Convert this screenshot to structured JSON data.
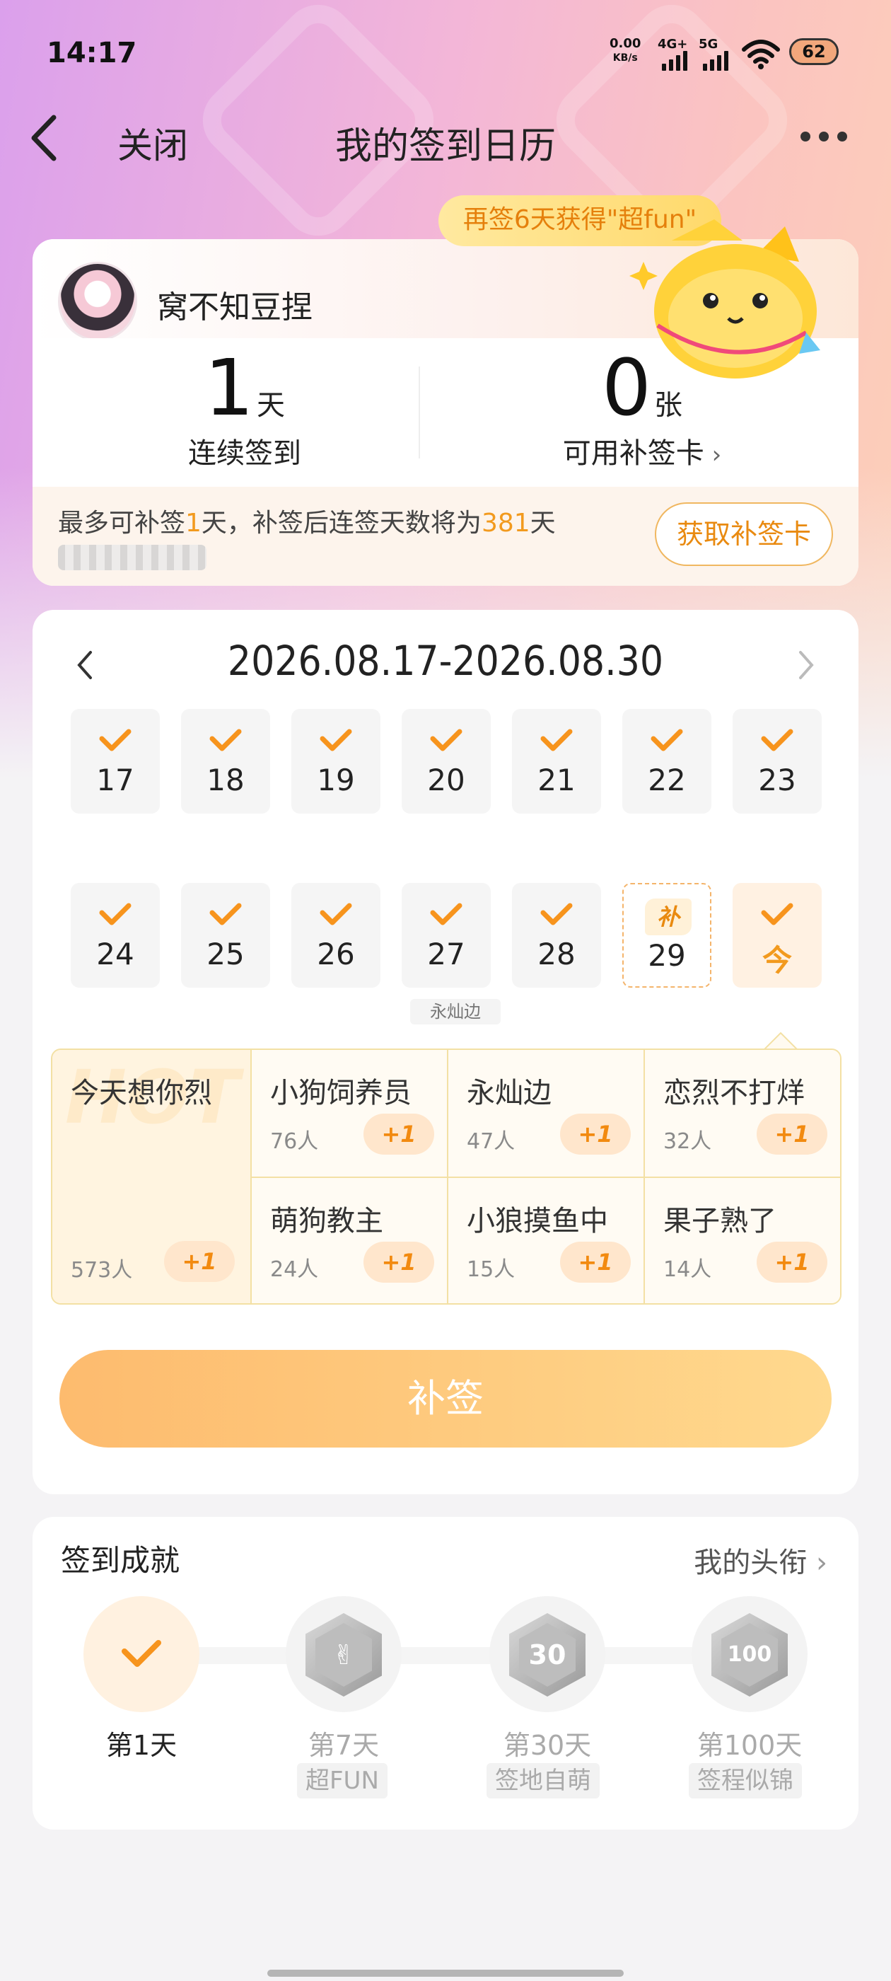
{
  "status_bar": {
    "time": "14:17",
    "net_speed": "0.00",
    "net_unit": "KB/s",
    "sig1": "4G+",
    "sig2": "5G",
    "battery": "62"
  },
  "titlebar": {
    "close_label": "关闭",
    "title": "我的签到日历"
  },
  "banner": {
    "bubble": "再签6天获得\"超fun\""
  },
  "profile": {
    "username": "窝不知豆捏",
    "streak_num": "1",
    "streak_unit": "天",
    "streak_label": "连续签到",
    "cards_num": "0",
    "cards_unit": "张",
    "cards_label": "可用补签卡",
    "note_a": "最多可补签",
    "note_days": "1",
    "note_b": "天，补签后连签天数将为",
    "note_total": "381",
    "note_c": "天",
    "get_card_button": "获取补签卡"
  },
  "calendar": {
    "range": "2026.08.17-2026.08.30",
    "days_row1": [
      "17",
      "18",
      "19",
      "20",
      "21",
      "22",
      "23"
    ],
    "days_row2": [
      "24",
      "25",
      "26",
      "27",
      "28"
    ],
    "makeup_tag": "补",
    "makeup_day": "29",
    "today_label": "今",
    "under_label": "永灿边"
  },
  "ranking": {
    "top": {
      "name": "今天想你烈",
      "count": "573人",
      "plus": "+1",
      "hot_watermark": "HOT"
    },
    "items": [
      {
        "name": "小狗饲养员",
        "count": "76人",
        "plus": "+1"
      },
      {
        "name": "永灿边",
        "count": "47人",
        "plus": "+1"
      },
      {
        "name": "恋烈不打烊",
        "count": "32人",
        "plus": "+1"
      },
      {
        "name": "萌狗教主",
        "count": "24人",
        "plus": "+1"
      },
      {
        "name": "小狼摸鱼中",
        "count": "15人",
        "plus": "+1"
      },
      {
        "name": "果子熟了",
        "count": "14人",
        "plus": "+1"
      }
    ]
  },
  "makeup_button": "补签",
  "achievements": {
    "title": "签到成就",
    "link": "我的头衔",
    "milestones": [
      {
        "label": "第1天",
        "tag": "",
        "badge": ""
      },
      {
        "label": "第7天",
        "tag": "超FUN",
        "badge": ""
      },
      {
        "label": "第30天",
        "tag": "签地自萌",
        "badge": "30"
      },
      {
        "label": "第100天",
        "tag": "签程似锦",
        "badge": "100"
      }
    ]
  },
  "colors": {
    "accent": "#f29a1e",
    "button_gradient_start": "#fdbb6e",
    "button_gradient_end": "#ffd98e"
  }
}
